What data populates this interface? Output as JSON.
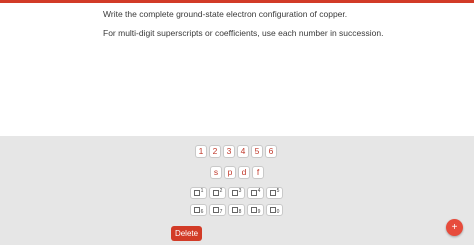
{
  "question": {
    "line1": "Write the complete ground-state electron configuration of copper.",
    "line2": "For multi-digit superscripts or coefficients, use each number in succession."
  },
  "keypad": {
    "numbers": [
      "1",
      "2",
      "3",
      "4",
      "5",
      "6"
    ],
    "orbitals": [
      "s",
      "p",
      "d",
      "f"
    ],
    "superscripts": [
      "1",
      "2",
      "3",
      "4",
      "5"
    ],
    "subscripts": [
      "6",
      "7",
      "8",
      "9",
      "0"
    ]
  },
  "delete_label": "Delete",
  "fab_label": "+",
  "colors": {
    "accent": "#d23b27",
    "panel": "#e6e6e6"
  }
}
